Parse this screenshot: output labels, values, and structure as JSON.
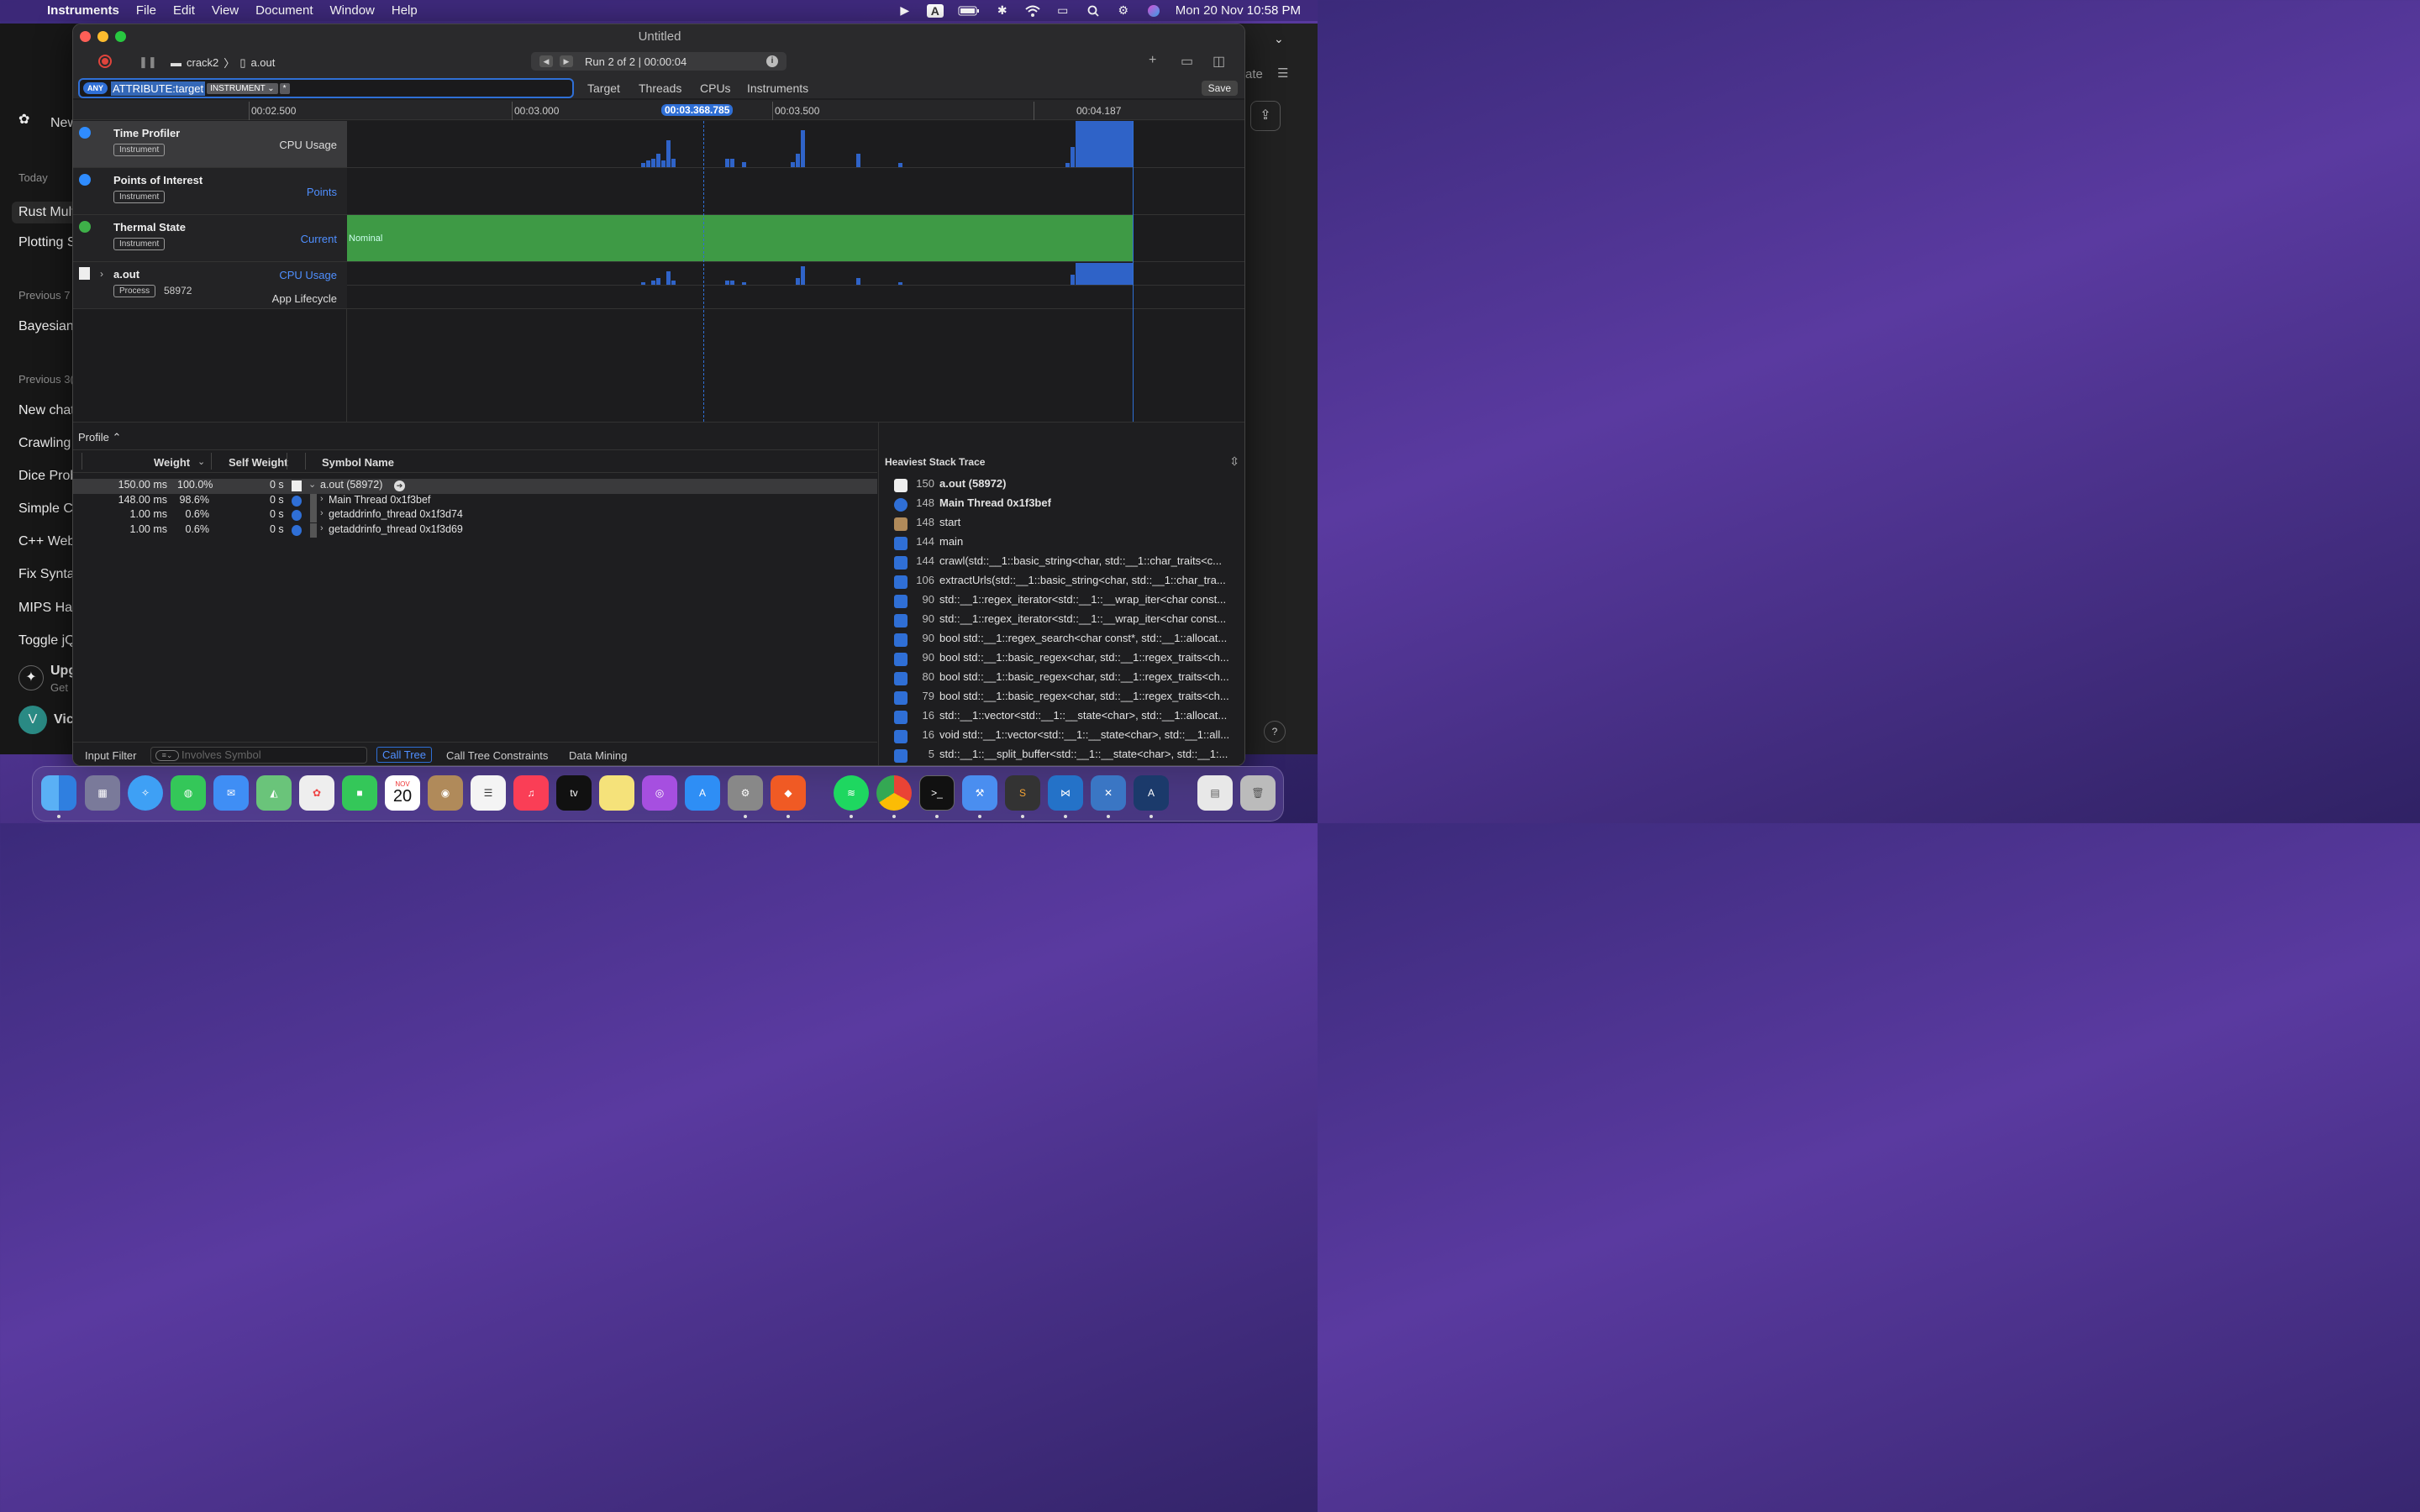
{
  "menubar": {
    "app_name": "Instruments",
    "menus": [
      "File",
      "Edit",
      "View",
      "Document",
      "Window",
      "Help"
    ],
    "clock": "Mon 20 Nov  10:58 PM"
  },
  "bg_app": {
    "new_chat": "New",
    "sections": [
      {
        "label": "Today",
        "items": [
          "Rust Mult",
          "Plotting S"
        ]
      },
      {
        "label": "Previous 7",
        "items": [
          "Bayesian"
        ]
      },
      {
        "label": "Previous 3(",
        "items": [
          "New chat",
          "Crawling",
          "Dice Prob",
          "Simple C",
          "C++ Web",
          "Fix Synta",
          "MIPS Haz",
          "Toggle jQ"
        ]
      }
    ],
    "upgrade": "Upg",
    "upgrade_sub": "Get",
    "user_initial": "V",
    "user_name": "Vic",
    "right_label": "ate"
  },
  "window": {
    "title": "Untitled",
    "crumb_target": "crack2",
    "crumb_file": "a.out",
    "run_text": "Run 2 of 2  |  00:00:04",
    "filter": {
      "any": "ANY",
      "token": "ATTRIBUTE:target",
      "chip": "INSTRUMENT ⌄",
      "star": "*"
    },
    "scopes": [
      "Target",
      "Threads",
      "CPUs",
      "Instruments"
    ],
    "save": "Save"
  },
  "ruler": {
    "ticks": [
      "00:02.500",
      "00:03.000",
      "00:03.500",
      "00:04.187"
    ],
    "playhead": "00:03.368.785"
  },
  "tracks": [
    {
      "name": "Time Profiler",
      "badge": "Instrument",
      "graph": "CPU Usage"
    },
    {
      "name": "Points of Interest",
      "badge": "Instrument",
      "graph": "Points"
    },
    {
      "name": "Thermal State",
      "badge": "Instrument",
      "graph": "Current",
      "state": "Nominal"
    },
    {
      "name": "a.out",
      "badge": "Process",
      "pid": "58972",
      "graph": "CPU Usage",
      "graph2": "App Lifecycle"
    }
  ],
  "profile": {
    "selector": "Profile ⌃",
    "columns": {
      "weight": "Weight",
      "self_weight": "Self Weight",
      "symbol": "Symbol Name"
    },
    "rows": [
      {
        "weight": "150.00 ms",
        "pct": "100.0%",
        "self": "0 s",
        "symbol": "a.out (58972)",
        "expanded": true
      },
      {
        "weight": "148.00 ms",
        "pct": "98.6%",
        "self": "0 s",
        "symbol": "Main Thread  0x1f3bef"
      },
      {
        "weight": "1.00 ms",
        "pct": "0.6%",
        "self": "0 s",
        "symbol": "getaddrinfo_thread  0x1f3d74"
      },
      {
        "weight": "1.00 ms",
        "pct": "0.6%",
        "self": "0 s",
        "symbol": "getaddrinfo_thread  0x1f3d69"
      }
    ]
  },
  "heaviest": {
    "title": "Heaviest Stack Trace",
    "rows": [
      {
        "count": "150",
        "name": "a.out (58972)",
        "icon": "doc-icon",
        "bold": true
      },
      {
        "count": "148",
        "name": "Main Thread  0x1f3bef",
        "icon": "thread-icon",
        "bold": true
      },
      {
        "count": "148",
        "name": "start",
        "icon": "library-icon"
      },
      {
        "count": "144",
        "name": "main",
        "icon": "user-icon"
      },
      {
        "count": "144",
        "name": "crawl(std::__1::basic_string<char, std::__1::char_traits<c...",
        "icon": "user-icon"
      },
      {
        "count": "106",
        "name": "extractUrls(std::__1::basic_string<char, std::__1::char_tra...",
        "icon": "user-icon"
      },
      {
        "count": "90",
        "name": "std::__1::regex_iterator<std::__1::__wrap_iter<char const...",
        "icon": "user-icon"
      },
      {
        "count": "90",
        "name": "std::__1::regex_iterator<std::__1::__wrap_iter<char const...",
        "icon": "user-icon"
      },
      {
        "count": "90",
        "name": "bool std::__1::regex_search<char const*, std::__1::allocat...",
        "icon": "user-icon"
      },
      {
        "count": "90",
        "name": "bool std::__1::basic_regex<char, std::__1::regex_traits<ch...",
        "icon": "user-icon"
      },
      {
        "count": "80",
        "name": "bool std::__1::basic_regex<char, std::__1::regex_traits<ch...",
        "icon": "user-icon"
      },
      {
        "count": "79",
        "name": "bool std::__1::basic_regex<char, std::__1::regex_traits<ch...",
        "icon": "user-icon"
      },
      {
        "count": "16",
        "name": "std::__1::vector<std::__1::__state<char>, std::__1::allocat...",
        "icon": "user-icon"
      },
      {
        "count": "16",
        "name": "void std::__1::vector<std::__1::__state<char>, std::__1::all...",
        "icon": "user-icon"
      },
      {
        "count": "5",
        "name": "std::__1::__split_buffer<std::__1::__state<char>, std::__1:...",
        "icon": "user-icon"
      }
    ]
  },
  "footer": {
    "input_filter": "Input Filter",
    "placeholder": "Involves Symbol",
    "tabs": [
      "Call Tree",
      "Call Tree Constraints",
      "Data Mining"
    ]
  },
  "dock": {
    "calendar_month": "NOV",
    "calendar_day": "20"
  }
}
